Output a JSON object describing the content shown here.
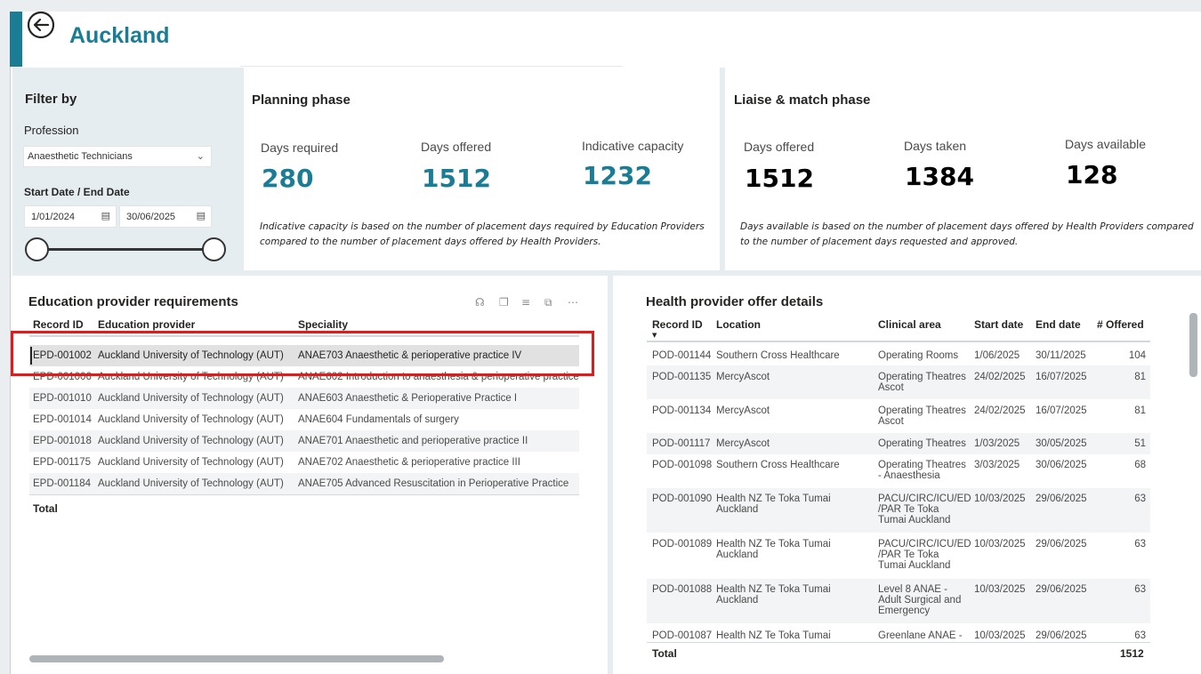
{
  "header": {
    "title": "Auckland",
    "back_icon": "back-arrow-circle-icon",
    "accent": "#1b7d95"
  },
  "filter": {
    "title": "Filter by",
    "profession_label": "Profession",
    "profession_value": "Anaesthetic Technicians",
    "date_label": "Start Date / End Date",
    "start_date": "1/01/2024",
    "end_date": "30/06/2025"
  },
  "planning": {
    "title": "Planning phase",
    "metrics": [
      {
        "label": "Days required",
        "value": "280"
      },
      {
        "label": "Days offered",
        "value": "1512"
      },
      {
        "label": "Indicative capacity",
        "value": "1232"
      }
    ],
    "note": "Indicative capacity is based on the number of placement days required by Education Providers compared to the number of placement days offered by Health Providers.",
    "color": "#1b7d95"
  },
  "liaise": {
    "title": "Liaise & match phase",
    "metrics": [
      {
        "label": "Days offered",
        "value": "1512"
      },
      {
        "label": "Days taken",
        "value": "1384"
      },
      {
        "label": "Days available",
        "value": "128"
      }
    ],
    "note": "Days available is based on the number of placement days offered by Health Providers compared to the number of placement days requested and approved."
  },
  "education": {
    "title": "Education provider requirements",
    "columns": [
      "Record ID",
      "Education provider",
      "Speciality"
    ],
    "rows": [
      [
        "EPD-001002",
        "Auckland University of Technology (AUT)",
        "ANAE703 Anaesthetic & perioperative practice IV"
      ],
      [
        "EPD-001006",
        "Auckland University of Technology (AUT)",
        "ANAE602 Introduction to anaesthesia & perioperative practice"
      ],
      [
        "EPD-001010",
        "Auckland University of Technology (AUT)",
        "ANAE603 Anaesthetic & Perioperative Practice I"
      ],
      [
        "EPD-001014",
        "Auckland University of Technology (AUT)",
        "ANAE604 Fundamentals of surgery"
      ],
      [
        "EPD-001018",
        "Auckland University of Technology (AUT)",
        "ANAE701 Anaesthetic and perioperative practice II"
      ],
      [
        "EPD-001175",
        "Auckland University of Technology (AUT)",
        "ANAE702 Anaesthetic & perioperative practice III"
      ],
      [
        "EPD-001184",
        "Auckland University of Technology (AUT)",
        "ANAE705 Advanced Resuscitation in Perioperative Practice"
      ]
    ],
    "total_label": "Total",
    "tool_icons": [
      "pin-icon",
      "copy-icon",
      "filter-icon",
      "focus-mode-icon",
      "more-options-icon"
    ]
  },
  "health": {
    "title": "Health provider offer details",
    "columns": [
      "Record ID",
      "Location",
      "Clinical area",
      "Start date",
      "End date",
      "# Offered"
    ],
    "rows": [
      {
        "lines": [
          [
            "POD-001144",
            "Southern Cross Healthcare",
            "Operating Rooms",
            "1/06/2025",
            "30/11/2025",
            "104"
          ]
        ]
      },
      {
        "lines": [
          [
            "POD-001135",
            "MercyAscot",
            "Operating Theatres",
            "24/02/2025",
            "16/07/2025",
            "81"
          ],
          [
            "",
            "",
            "Ascot",
            "",
            "",
            ""
          ]
        ]
      },
      {
        "lines": [
          [
            "POD-001134",
            "MercyAscot",
            "Operating Theatres",
            "24/02/2025",
            "16/07/2025",
            "81"
          ],
          [
            "",
            "",
            "Ascot",
            "",
            "",
            ""
          ]
        ]
      },
      {
        "lines": [
          [
            "POD-001117",
            "MercyAscot",
            "Operating Theatres",
            "1/03/2025",
            "30/05/2025",
            "51"
          ]
        ]
      },
      {
        "lines": [
          [
            "POD-001098",
            "Southern Cross Healthcare",
            "Operating Theatres",
            "3/03/2025",
            "30/06/2025",
            "68"
          ],
          [
            "",
            "",
            "- Anaesthesia",
            "",
            "",
            ""
          ]
        ]
      },
      {
        "lines": [
          [
            "POD-001090",
            "Health NZ Te Toka Tumai",
            "PACU/CIRC/ICU/ED",
            "10/03/2025",
            "29/06/2025",
            "63"
          ],
          [
            "",
            "Auckland",
            "/PAR Te Toka",
            "",
            "",
            ""
          ],
          [
            "",
            "",
            "Tumai Auckland",
            "",
            "",
            ""
          ]
        ]
      },
      {
        "lines": [
          [
            "POD-001089",
            "Health NZ Te Toka Tumai",
            "PACU/CIRC/ICU/ED",
            "10/03/2025",
            "29/06/2025",
            "63"
          ],
          [
            "",
            "Auckland",
            "/PAR Te Toka",
            "",
            "",
            ""
          ],
          [
            "",
            "",
            "Tumai Auckland",
            "",
            "",
            ""
          ]
        ]
      },
      {
        "lines": [
          [
            "POD-001088",
            "Health NZ Te Toka Tumai",
            "Level 8 ANAE -",
            "10/03/2025",
            "29/06/2025",
            "63"
          ],
          [
            "",
            "Auckland",
            "Adult Surgical and",
            "",
            "",
            ""
          ],
          [
            "",
            "",
            "Emergency",
            "",
            "",
            ""
          ]
        ]
      },
      {
        "lines": [
          [
            "POD-001087",
            "Health NZ Te Toka Tumai",
            "Greenlane ANAE -",
            "10/03/2025",
            "29/06/2025",
            "63"
          ]
        ]
      }
    ],
    "total_label": "Total",
    "total_value": "1512"
  }
}
